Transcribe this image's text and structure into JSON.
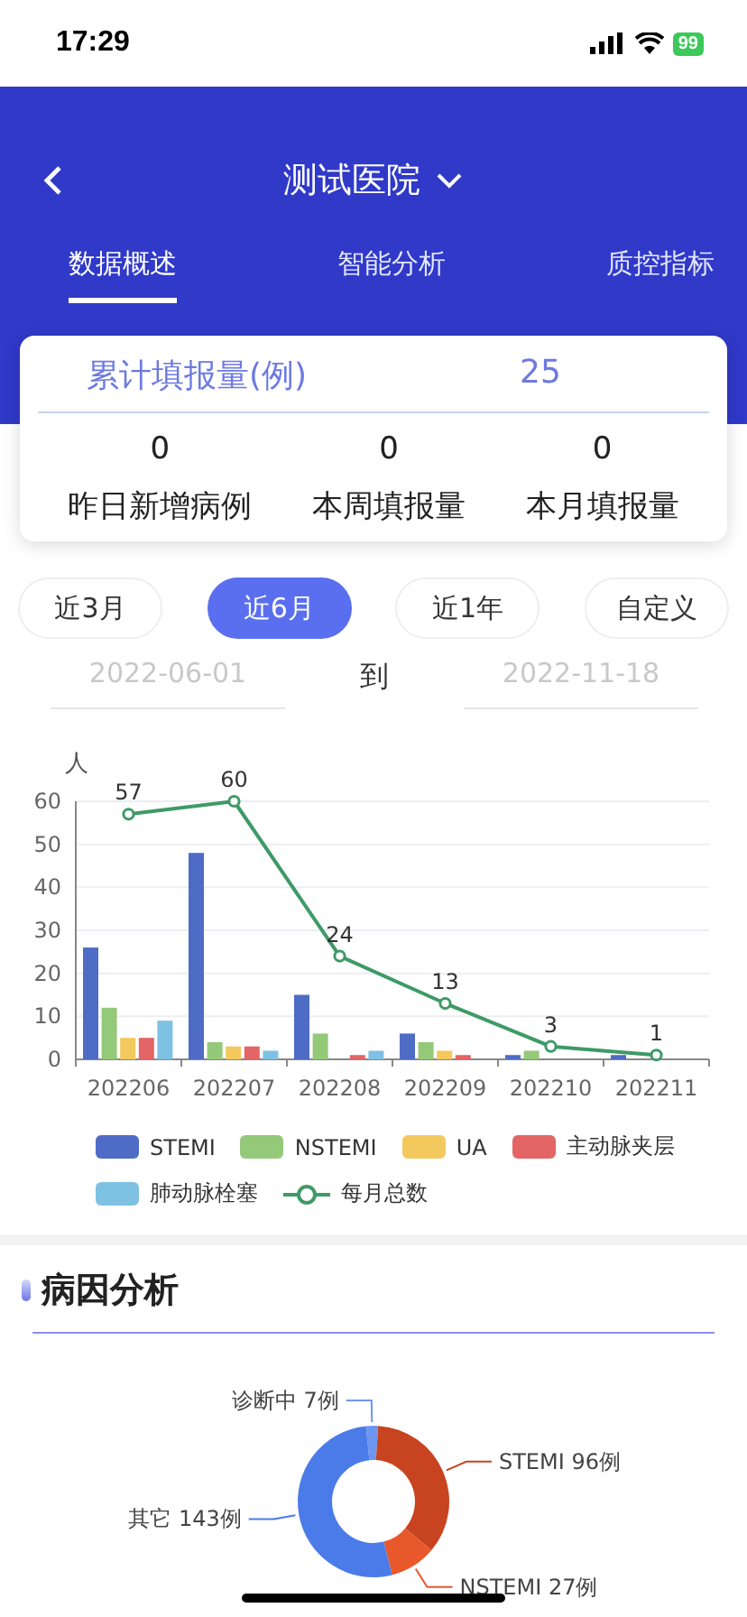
{
  "status_bar": {
    "time": "17:29",
    "battery": "99"
  },
  "header": {
    "title": "测试医院"
  },
  "tabs": [
    {
      "label": "数据概述",
      "selected": true
    },
    {
      "label": "智能分析",
      "selected": false
    },
    {
      "label": "质控指标",
      "selected": false
    }
  ],
  "summary": {
    "total_label": "累计填报量(例)",
    "total_value": "25",
    "stats": [
      {
        "value": "0",
        "label": "昨日新增病例"
      },
      {
        "value": "0",
        "label": "本周填报量"
      },
      {
        "value": "0",
        "label": "本月填报量"
      }
    ]
  },
  "ranges": [
    {
      "label": "近3月",
      "selected": false
    },
    {
      "label": "近6月",
      "selected": true
    },
    {
      "label": "近1年",
      "selected": false
    },
    {
      "label": "自定义",
      "selected": false
    }
  ],
  "date_range": {
    "start": {
      "placeholder": "2022-06-01"
    },
    "separator": "到",
    "end": {
      "placeholder": "2022-11-18"
    }
  },
  "trend_chart": {
    "chart_data": {
      "type": "bar",
      "ylabel": "人",
      "categories": [
        "202206",
        "202207",
        "202208",
        "202209",
        "202210",
        "202211"
      ],
      "ylim": [
        0,
        60
      ],
      "yticks": [
        0,
        10,
        20,
        30,
        40,
        50,
        60
      ],
      "series": [
        {
          "name": "STEMI",
          "color": "#4e6bc6",
          "values": [
            26,
            48,
            15,
            6,
            1,
            1
          ]
        },
        {
          "name": "NSTEMI",
          "color": "#93c978",
          "values": [
            12,
            4,
            6,
            4,
            2,
            0
          ]
        },
        {
          "name": "UA",
          "color": "#f3c95e",
          "values": [
            5,
            3,
            0,
            2,
            0,
            0
          ]
        },
        {
          "name": "主动脉夹层",
          "color": "#e36565",
          "values": [
            5,
            3,
            1,
            1,
            0,
            0
          ]
        },
        {
          "name": "肺动脉栓塞",
          "color": "#7fc1e3",
          "values": [
            9,
            2,
            2,
            0,
            0,
            0
          ]
        },
        {
          "name": "每月总数",
          "color": "#3e9a66",
          "type": "line",
          "marker": "circle",
          "values": [
            57,
            60,
            24,
            13,
            3,
            1
          ],
          "value_labels": [
            "57",
            "60",
            "24",
            "13",
            "3",
            "1"
          ]
        }
      ],
      "grid": true,
      "legend": true
    }
  },
  "cause_section": {
    "title": "病因分析",
    "chart_data": {
      "type": "donut",
      "categories": [
        "诊断中 7例",
        "STEMI 96例",
        "NSTEMI 27例",
        "其它 143例"
      ],
      "values": [
        7,
        96,
        27,
        143
      ],
      "colors": [
        "#6c96f0",
        "#c8431f",
        "#e8582a",
        "#4a7be8"
      ]
    }
  }
}
